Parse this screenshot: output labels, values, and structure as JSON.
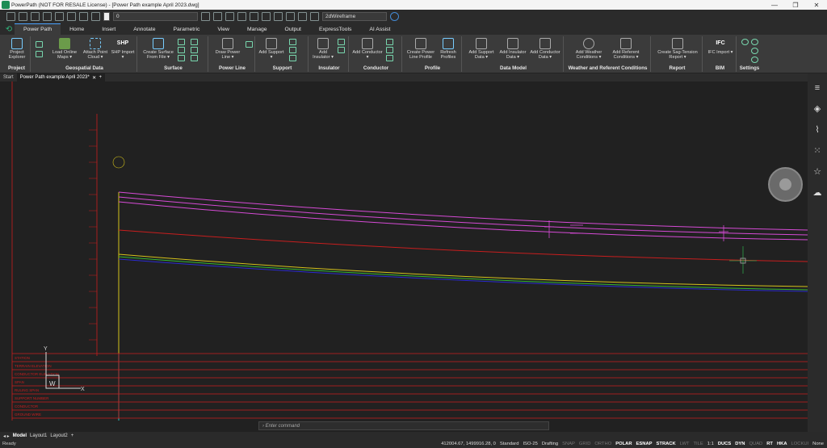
{
  "window": {
    "title": "PowerPath (NOT FOR RESALE License) - [Power Path example April 2023.dwg]",
    "buttons": [
      "—",
      "❐",
      "✕"
    ]
  },
  "qat": {
    "layer_value": "0",
    "visual_style": "2dWireframe"
  },
  "tabs": [
    "Power Path",
    "Home",
    "Insert",
    "Annotate",
    "Parametric",
    "View",
    "Manage",
    "Output",
    "ExpressTools",
    "AI Assist"
  ],
  "ribbon": {
    "panels": [
      {
        "title": "Project",
        "buttons": [
          "Project Explorer"
        ]
      },
      {
        "title": "Geospatial Data",
        "buttons": [
          "Load Online Maps ▾",
          "Attach Point Cloud ▾",
          "SHP Import ▾"
        ]
      },
      {
        "title": "Surface",
        "buttons": [
          "Create Surface From File ▾"
        ]
      },
      {
        "title": "Power Line",
        "buttons": [
          "Draw Power Line ▾"
        ]
      },
      {
        "title": "Support",
        "buttons": [
          "Add Support ▾"
        ]
      },
      {
        "title": "Insulator",
        "buttons": [
          "Add Insulator ▾"
        ]
      },
      {
        "title": "Conductor",
        "buttons": [
          "Add Conductor ▾"
        ]
      },
      {
        "title": "Profile",
        "buttons": [
          "Create Power Line Profile",
          "Refresh Profiles"
        ]
      },
      {
        "title": "Data Model",
        "buttons": [
          "Add Support Data ▾",
          "Add Insulator Data ▾",
          "Add Conductor Data ▾"
        ]
      },
      {
        "title": "Weather and Referent Conditions",
        "buttons": [
          "Add Weather Conditions ▾",
          "Add Referent Conditions ▾"
        ]
      },
      {
        "title": "Report",
        "buttons": [
          "Create Sag-Tension Report ▾"
        ]
      },
      {
        "title": "BIM",
        "buttons": [
          "IFC Import ▾"
        ]
      },
      {
        "title": "Settings",
        "buttons": []
      }
    ],
    "shp_label": "SHP",
    "ifc_label": "IFC"
  },
  "doc_tabs": [
    "Start",
    "Power Path example April 2023*"
  ],
  "profile_table_rows": [
    "STATION",
    "TERRAIN ELEVATION",
    "CONDUCTOR ELEVATION",
    "SPAN",
    "RULING SPAN",
    "SUPPORT NUMBER",
    "CONDUCTOR",
    "GROUND WIRE"
  ],
  "command": {
    "placeholder": "Enter command"
  },
  "layouts": [
    "Model",
    "Layout1",
    "Layout2"
  ],
  "status": {
    "ready": "Ready",
    "coords": "412004.67, 1499916.28, 0",
    "items": [
      "Standard",
      "ISO-25",
      "Drafting",
      "SNAP",
      "GRID",
      "ORTHO",
      "POLAR",
      "ESNAP",
      "STRACK",
      "LWT",
      "TILE",
      "1:1",
      "DUCS",
      "DYN",
      "QUAD",
      "RT",
      "HKA",
      "LOCKUI",
      "None"
    ],
    "on_items": [
      "POLAR",
      "ESNAP",
      "STRACK",
      "DUCS",
      "DYN",
      "RT",
      "HKA"
    ]
  },
  "colors": {
    "accent": "#4aa3ff",
    "brand": "#1e8c55",
    "magenta": "#d64bd6",
    "red": "#c81e1e",
    "yellow": "#d4c21a",
    "green": "#33b633",
    "blue": "#2a2ad0"
  }
}
